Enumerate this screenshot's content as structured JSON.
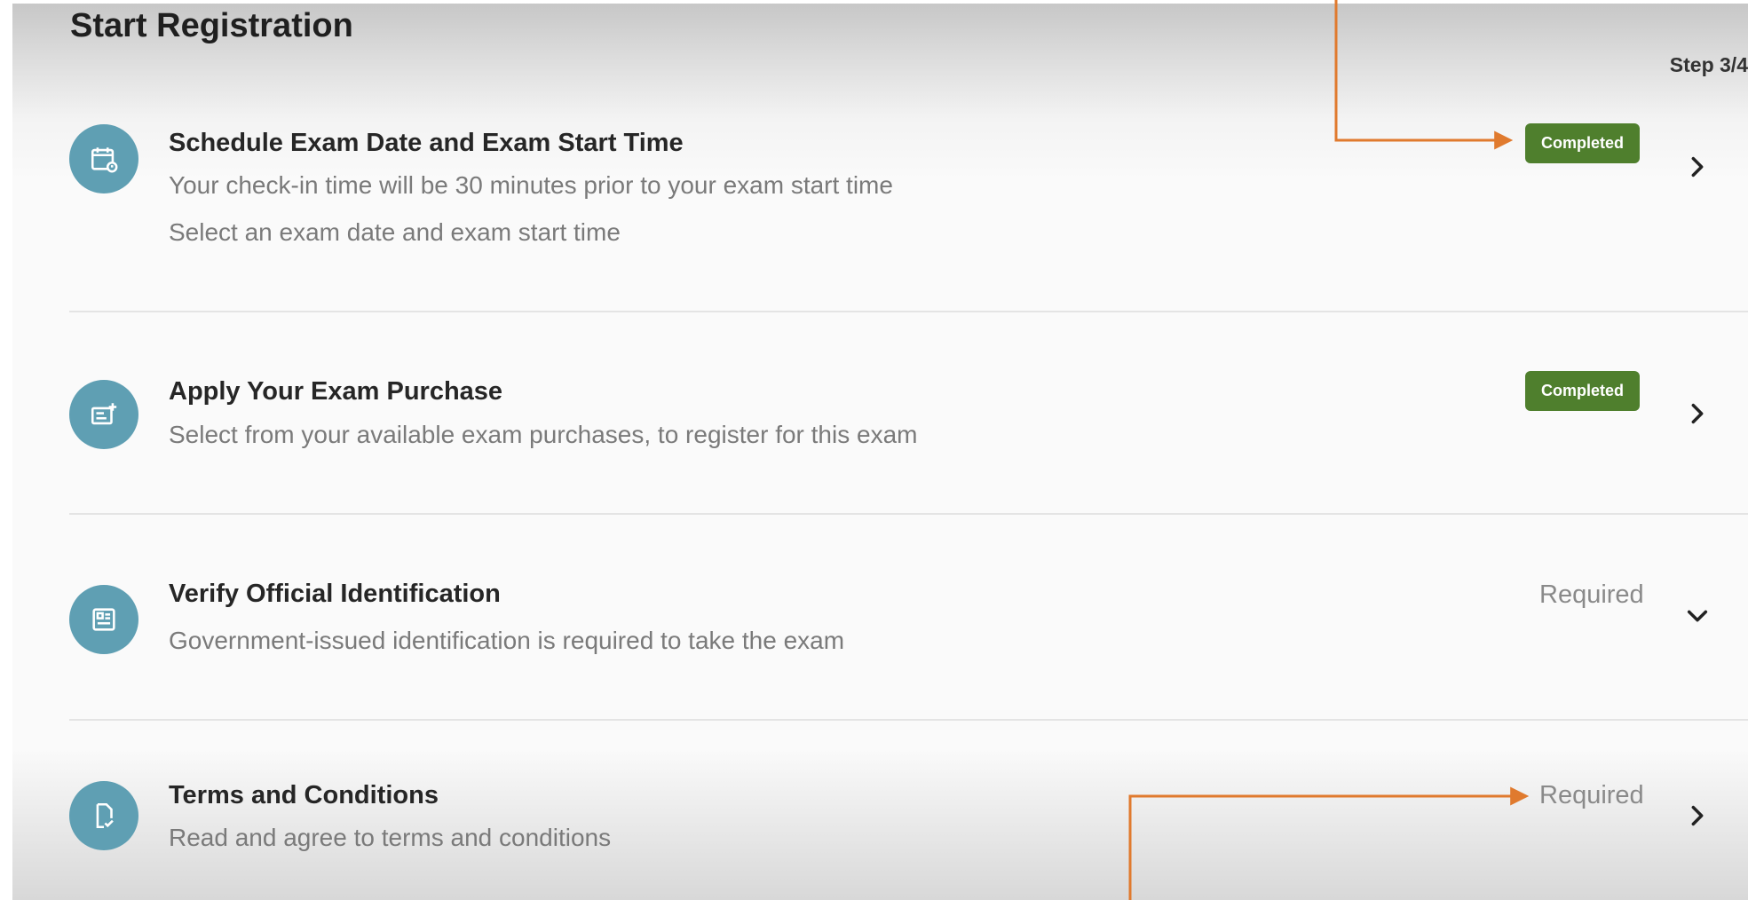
{
  "page": {
    "title": "Start Registration",
    "step": "Step 3/4"
  },
  "colors": {
    "icon_bg": "#5f9fb3",
    "completed_badge": "#4f7f2d",
    "required_text": "#8a8a8a",
    "annotation_arrow": "#e07a2e"
  },
  "steps": [
    {
      "title": "Schedule Exam Date and Exam Start Time",
      "descriptions": [
        "Your check-in time will be 30 minutes prior to your exam start time",
        "Select an exam date and exam start time"
      ],
      "status": "Completed",
      "icon": "calendar-icon",
      "chevron": "chevron-right-icon"
    },
    {
      "title": "Apply Your Exam Purchase",
      "descriptions": [
        "Select from your available exam purchases, to register for this exam"
      ],
      "status": "Completed",
      "icon": "ticket-icon",
      "chevron": "chevron-right-icon"
    },
    {
      "title": "Verify Official Identification",
      "descriptions": [
        "Government-issued identification is required to take the exam"
      ],
      "status": "Required",
      "icon": "id-card-icon",
      "chevron": "chevron-down-icon"
    },
    {
      "title": "Terms and Conditions",
      "descriptions": [
        "Read and agree to terms and conditions"
      ],
      "status": "Required",
      "icon": "document-check-icon",
      "chevron": "chevron-right-icon"
    }
  ]
}
